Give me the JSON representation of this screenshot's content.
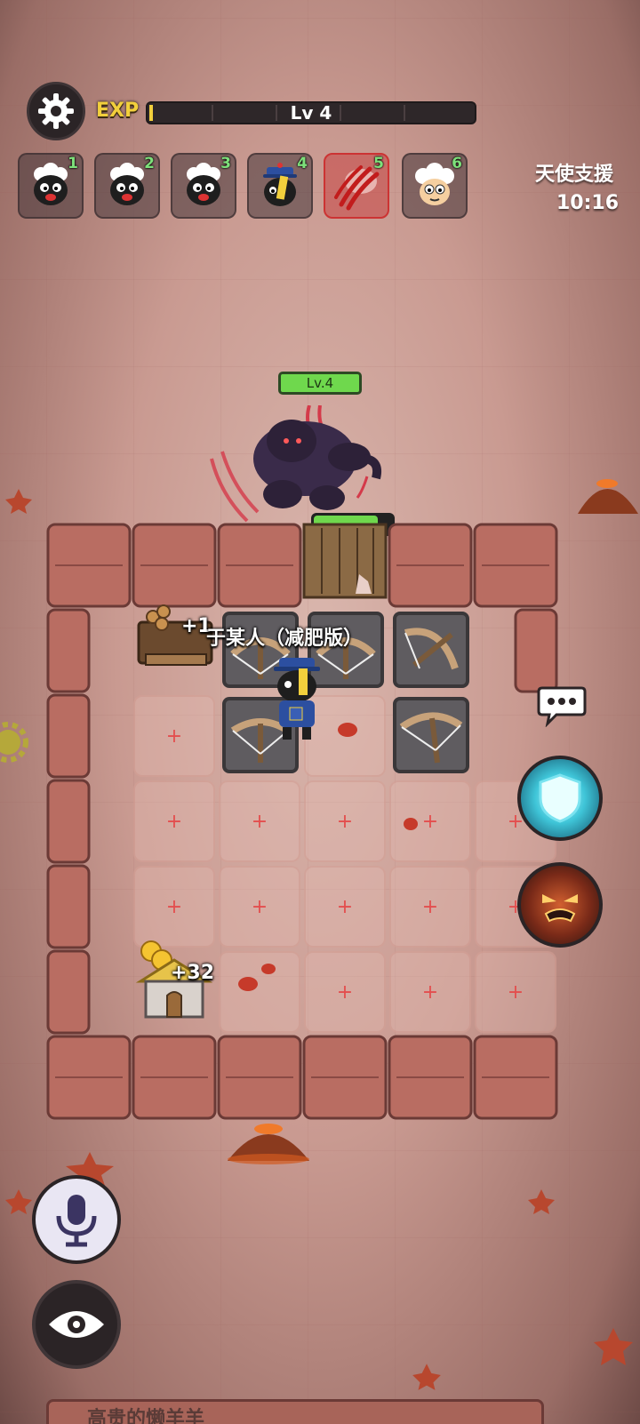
{
  "hud": {
    "exp_label": "EXP",
    "level_text": "Lv 4",
    "exp_progress": 0.01,
    "players": [
      {
        "num": "1",
        "icon": "sheep-black-icon"
      },
      {
        "num": "2",
        "icon": "sheep-black-icon"
      },
      {
        "num": "3",
        "icon": "sheep-black-icon"
      },
      {
        "num": "4",
        "icon": "sheep-official-hat-icon"
      },
      {
        "num": "5",
        "icon": "claw-marks-icon",
        "active": true
      },
      {
        "num": "6",
        "icon": "sheep-white-icon"
      }
    ]
  },
  "angel": {
    "title": "天使支援",
    "time": "10:16"
  },
  "boss": {
    "level": "Lv.4",
    "door_hp": 0.82
  },
  "floaters": {
    "wood_gain": "+1",
    "player_name": "于某人（减肥版）",
    "coin_gain": "+32"
  },
  "bottom": {
    "label": "高贵的懒羊羊"
  },
  "colors": {
    "accent_green": "#6fd84d",
    "exp_yellow": "#f2cf3c",
    "danger_red": "#e34e4e"
  }
}
